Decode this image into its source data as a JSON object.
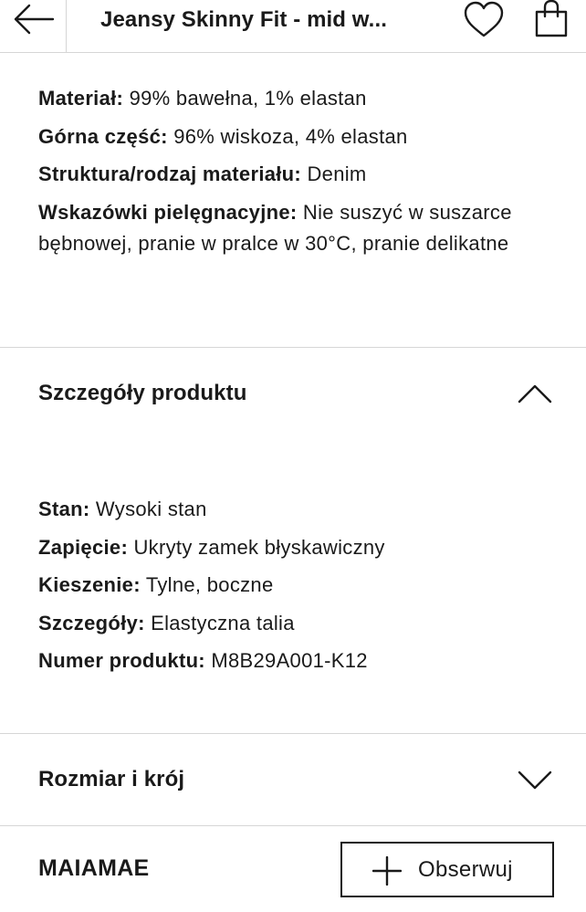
{
  "header": {
    "title": "Jeansy Skinny Fit - mid w...",
    "back_icon": "arrow-left-icon",
    "wishlist_icon": "heart-icon",
    "bag_icon": "shopping-bag-icon"
  },
  "material": {
    "items": [
      {
        "label": "Materiał:",
        "value": " 99% bawełna, 1% elastan"
      },
      {
        "label": "Górna część:",
        "value": " 96% wiskoza, 4% elastan"
      },
      {
        "label": "Struktura/rodzaj materiału:",
        "value": " Denim"
      },
      {
        "label": "Wskazówki pielęgnacyjne:",
        "value": " Nie suszyć w suszarce bębnowej, pranie w pralce w 30°C, pranie delikatne"
      }
    ]
  },
  "details": {
    "title": "Szczegóły produktu",
    "expanded": true,
    "chevron_icon": "chevron-up-icon",
    "items": [
      {
        "label": "Stan:",
        "value": " Wysoki stan"
      },
      {
        "label": "Zapięcie:",
        "value": " Ukryty zamek błyskawiczny"
      },
      {
        "label": "Kieszenie:",
        "value": " Tylne, boczne"
      },
      {
        "label": "Szczegóły:",
        "value": " Elastyczna talia"
      },
      {
        "label": "Numer produktu:",
        "value": " M8B29A001-K12"
      }
    ]
  },
  "size_fit": {
    "title": "Rozmiar i krój",
    "expanded": false,
    "chevron_icon": "chevron-down-icon"
  },
  "brand": {
    "name": "MAIAMAE",
    "follow_label": "Obserwuj",
    "follow_icon": "plus-icon"
  }
}
